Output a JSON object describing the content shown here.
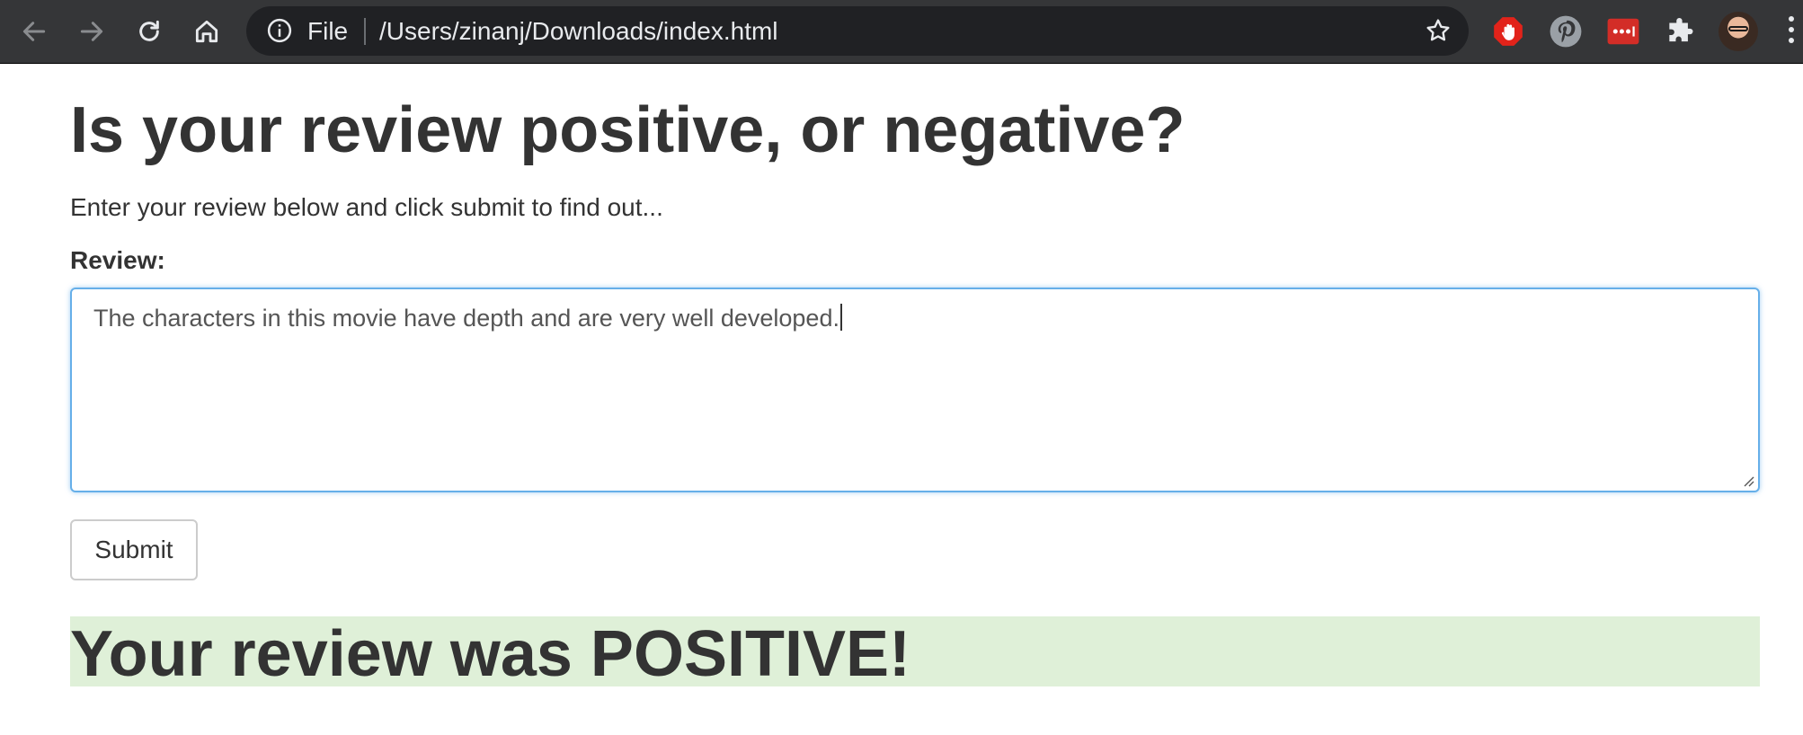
{
  "browser": {
    "scheme_label": "File",
    "url": "/Users/zinanj/Downloads/index.html",
    "icons": {
      "back": "arrow-left-icon",
      "forward": "arrow-right-icon",
      "reload": "reload-icon",
      "home": "home-icon",
      "site_info": "info-icon",
      "bookmark": "star-icon",
      "extensions": [
        "adblock-hand-icon",
        "pinterest-icon",
        "lastpass-icon",
        "puzzle-extensions-icon"
      ],
      "menu": "kebab-menu-icon"
    },
    "colors": {
      "toolbar": "#353638",
      "omnibox": "#202124",
      "adblock": "#e2231a",
      "lastpass": "#d32d27"
    }
  },
  "page": {
    "title": "Is your review positive, or negative?",
    "subtitle": "Enter your review below and click submit to find out...",
    "review_label": "Review:",
    "review_value": "The characters in this movie have depth and are very well developed.",
    "submit_label": "Submit",
    "result": "Your review was POSITIVE!",
    "colors": {
      "text": "#333333",
      "focus_border": "#66afe9",
      "result_bg": "#dff0d8"
    }
  }
}
